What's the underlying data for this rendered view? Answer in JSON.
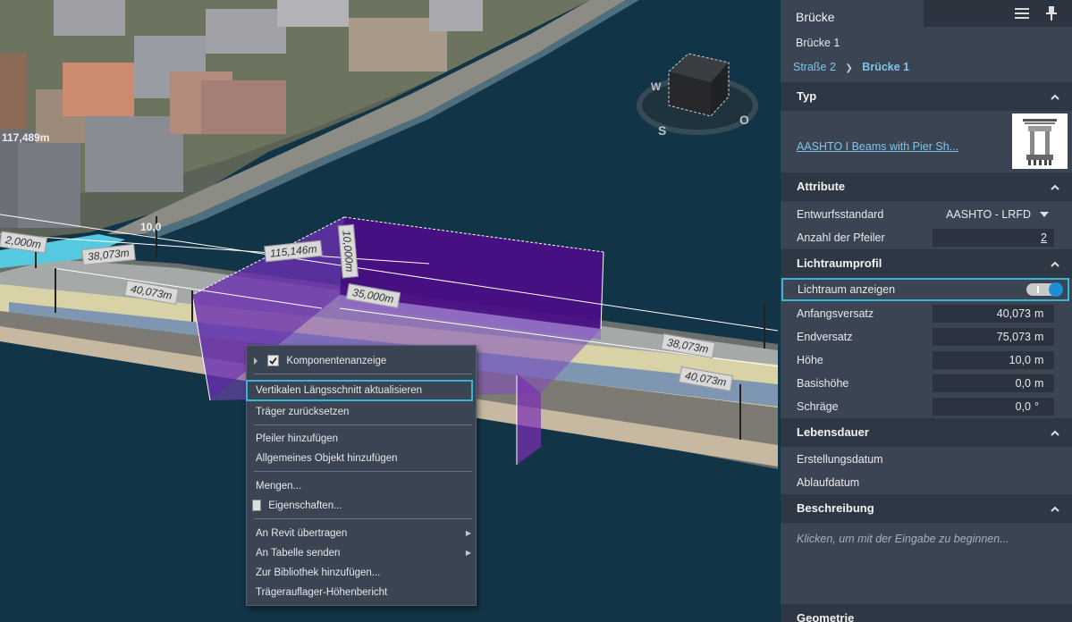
{
  "viewport": {
    "dim_labels": [
      "117,489m",
      "2,000m",
      "38,073m",
      "10,0",
      "115,146m",
      "10,000m",
      "40,073m",
      "35,000m",
      "38,073m",
      "40,073m"
    ],
    "nav_cube_letters": [
      "W",
      "S",
      "O"
    ]
  },
  "context_menu": {
    "items": [
      {
        "label": "Komponentenanzeige",
        "checked": true
      },
      {
        "label": "Vertikalen Längsschnitt aktualisieren"
      },
      {
        "label": "Träger zurücksetzen"
      },
      {
        "label": "Pfeiler hinzufügen"
      },
      {
        "label": "Allgemeines Objekt hinzufügen"
      },
      {
        "label": "Mengen..."
      },
      {
        "label": "Eigenschaften..."
      },
      {
        "label": "An Revit übertragen"
      },
      {
        "label": "An Tabelle senden"
      },
      {
        "label": "Zur Bibliothek hinzufügen..."
      },
      {
        "label": "Trägerauflager-Höhenbericht"
      }
    ]
  },
  "panel": {
    "title": "Brücke",
    "subtitle": "Brücke 1",
    "breadcrumb": {
      "parent": "Straße 2",
      "separator": "❯",
      "current": "Brücke 1"
    },
    "sections": {
      "typ": {
        "header": "Typ",
        "type_link": "AASHTO I Beams with Pier Sh..."
      },
      "attribute": {
        "header": "Attribute",
        "rows": [
          {
            "label": "Entwurfsstandard",
            "value": "AASHTO - LRFD"
          },
          {
            "label": "Anzahl der Pfeiler",
            "value": "2"
          }
        ]
      },
      "lichtraumprofil": {
        "header": "Lichtraumprofil",
        "toggle": {
          "label": "Lichtraum anzeigen",
          "on": true
        },
        "rows": [
          {
            "label": "Anfangsversatz",
            "value": "40,073",
            "unit": "m"
          },
          {
            "label": "Endversatz",
            "value": "75,073",
            "unit": "m"
          },
          {
            "label": "Höhe",
            "value": "10,0",
            "unit": "m"
          },
          {
            "label": "Basishöhe",
            "value": "0,0",
            "unit": "m"
          },
          {
            "label": "Schräge",
            "value": "0,0",
            "unit": "°"
          }
        ]
      },
      "lebensdauer": {
        "header": "Lebensdauer",
        "rows": [
          {
            "label": "Erstellungsdatum"
          },
          {
            "label": "Ablaufdatum"
          }
        ]
      },
      "beschreibung": {
        "header": "Beschreibung",
        "placeholder": "Klicken, um mit der Eingabe zu beginnen..."
      },
      "geometrie": {
        "header": "Geometrie"
      }
    }
  },
  "colors": {
    "panel_bg": "#3b4453",
    "section_header_bg": "#2e3744",
    "accent": "#3ab4d6",
    "clearance_box": "#5a1a9e",
    "water": "#123447"
  }
}
